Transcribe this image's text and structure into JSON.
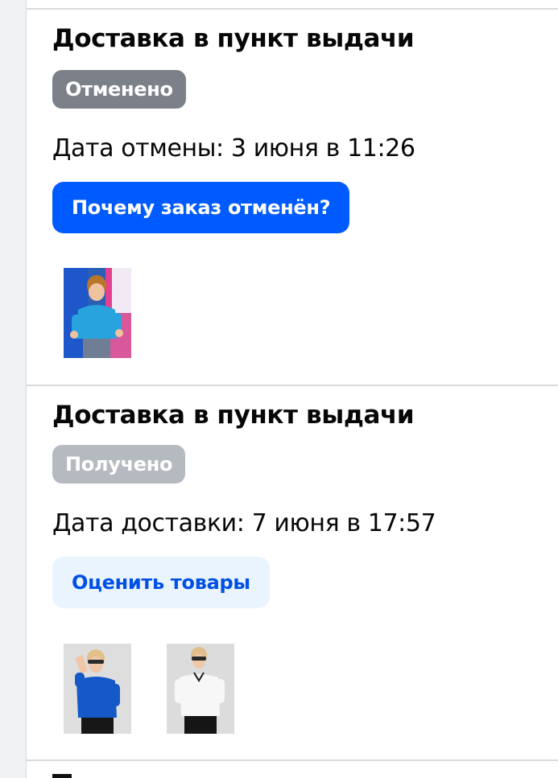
{
  "orders": [
    {
      "title": "Доставка в пункт выдачи",
      "status": "Отменено",
      "date_line": "Дата отмены: 3 июня в 11:26",
      "action_label": "Почему заказ отменён?",
      "products": [
        {
          "icon": "boy-light-blue-polo-photo"
        }
      ]
    },
    {
      "title": "Доставка в пункт выдачи",
      "status": "Получено",
      "date_line": "Дата доставки: 7 июня в 17:57",
      "action_label": "Оценить товары",
      "products": [
        {
          "icon": "boy-blue-polo-photo"
        },
        {
          "icon": "boy-white-polo-photo"
        }
      ]
    }
  ],
  "colors": {
    "page_background": "#f1f2f4",
    "card_background": "#ffffff",
    "badge_cancelled": "#7b8089",
    "badge_received": "#b5b9c0",
    "primary_button": "#005bff",
    "secondary_button_bg": "#eaf4ff",
    "secondary_button_text": "#0050e6"
  }
}
